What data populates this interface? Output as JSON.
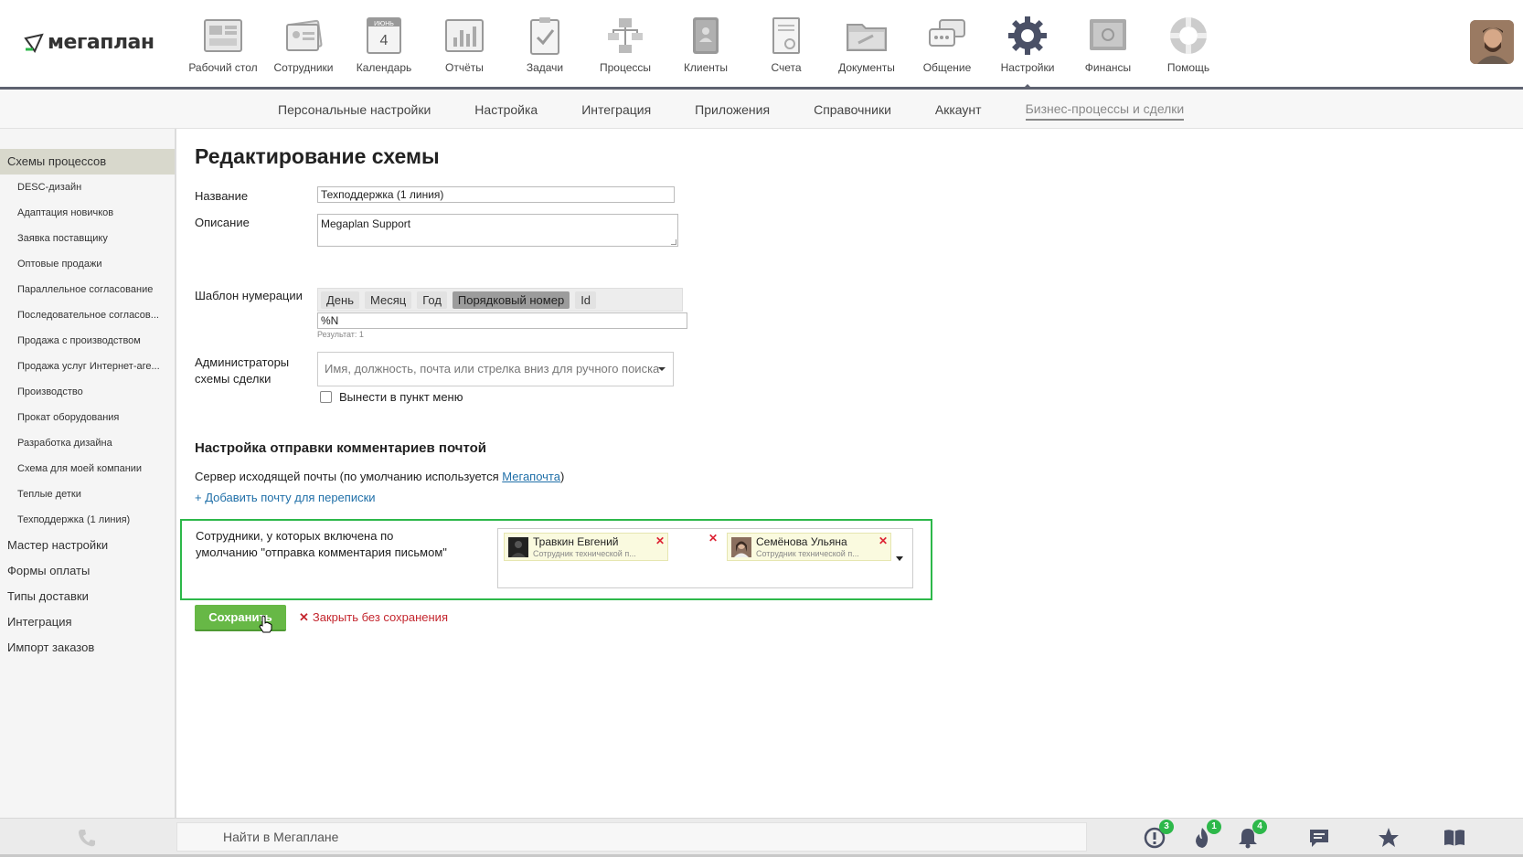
{
  "brand": {
    "logo_text": "мегаплан",
    "accent": "#2db84a"
  },
  "nav": [
    {
      "label": "Рабочий стол",
      "icon": "desktop-icon"
    },
    {
      "label": "Сотрудники",
      "icon": "employees-icon"
    },
    {
      "label": "Календарь",
      "icon": "calendar-icon",
      "month": "ИЮНЬ",
      "day": "4"
    },
    {
      "label": "Отчёты",
      "icon": "reports-icon"
    },
    {
      "label": "Задачи",
      "icon": "tasks-icon"
    },
    {
      "label": "Процессы",
      "icon": "processes-icon"
    },
    {
      "label": "Клиенты",
      "icon": "clients-icon"
    },
    {
      "label": "Счета",
      "icon": "invoices-icon"
    },
    {
      "label": "Документы",
      "icon": "documents-icon"
    },
    {
      "label": "Общение",
      "icon": "chat-icon"
    },
    {
      "label": "Настройки",
      "icon": "settings-gear-icon",
      "active": true
    },
    {
      "label": "Финансы",
      "icon": "finance-safe-icon"
    },
    {
      "label": "Помощь",
      "icon": "help-lifebuoy-icon"
    }
  ],
  "subnav": [
    "Персональные настройки",
    "Настройка",
    "Интеграция",
    "Приложения",
    "Справочники",
    "Аккаунт",
    "Бизнес-процессы и сделки"
  ],
  "sidebar": {
    "head": "Схемы процессов",
    "schemes": [
      "DESC-дизайн",
      "Адаптация новичков",
      "Заявка поставщику",
      "Оптовые продажи",
      "Параллельное согласование",
      "Последовательное согласов...",
      "Продажа с производством",
      "Продажа услуг Интернет-аге...",
      "Производство",
      "Прокат оборудования",
      "Разработка дизайна",
      "Схема для моей компании",
      "Теплые детки",
      "Техподдержка (1 линия)"
    ],
    "sections": [
      "Мастер настройки",
      "Формы оплаты",
      "Типы доставки",
      "Интеграция",
      "Импорт заказов"
    ]
  },
  "form": {
    "title": "Редактирование схемы",
    "name_label": "Название",
    "name_value": "Техподдержка (1 линия)",
    "desc_label": "Описание",
    "desc_value": "Megaplan Support",
    "menu_checkbox_label": "Вынести в пункт меню",
    "numbering_label": "Шаблон нумерации",
    "numbering_tokens": [
      "День",
      "Месяц",
      "Год",
      "Порядковый номер",
      "Id"
    ],
    "numbering_value": "%N",
    "numbering_result": "Результат: 1",
    "admins_label_line1": "Администраторы",
    "admins_label_line2": "схемы сделки",
    "admins_placeholder": "Имя, должность, почта или стрелка вниз для ручного поиска"
  },
  "mail": {
    "section_title": "Настройка отправки комментариев почтой",
    "server_text": "Сервер исходящей почты (по умолчанию используется ",
    "server_link": "Мегапочта",
    "server_close": ")",
    "add_link": "+ Добавить почту для переписки",
    "employees_label_line1": "Сотрудники, у которых включена по",
    "employees_label_line2": "умолчанию \"отправка комментария письмом\"",
    "employees": [
      {
        "name": "Травкин Евгений",
        "role": "Сотрудник технической п..."
      },
      {
        "name": "Семёнова Ульяна",
        "role": "Сотрудник технической п..."
      }
    ]
  },
  "actions": {
    "save": "Сохранить",
    "close": "Закрыть без сохранения"
  },
  "bottom": {
    "search_placeholder": "Найти в Мегаплане",
    "badges": {
      "alerts": "3",
      "hot": "1",
      "notifications": "4"
    }
  }
}
